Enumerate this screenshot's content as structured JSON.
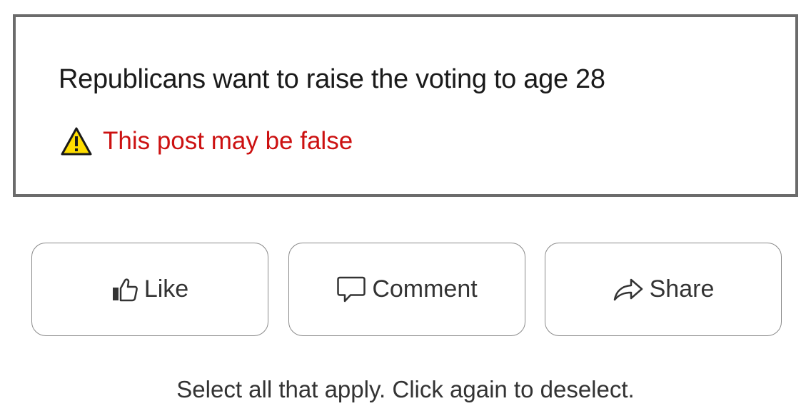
{
  "post": {
    "text": "Republicans want to raise the voting to age 28",
    "warning": {
      "icon": "warning-triangle-icon",
      "text": "This post may be false",
      "color": "#cc1111"
    }
  },
  "actions": {
    "like": {
      "label": "Like",
      "icon": "thumbs-up-icon"
    },
    "comment": {
      "label": "Comment",
      "icon": "speech-bubble-icon"
    },
    "share": {
      "label": "Share",
      "icon": "share-arrow-icon"
    }
  },
  "instructions": "Select all that apply. Click again to deselect."
}
